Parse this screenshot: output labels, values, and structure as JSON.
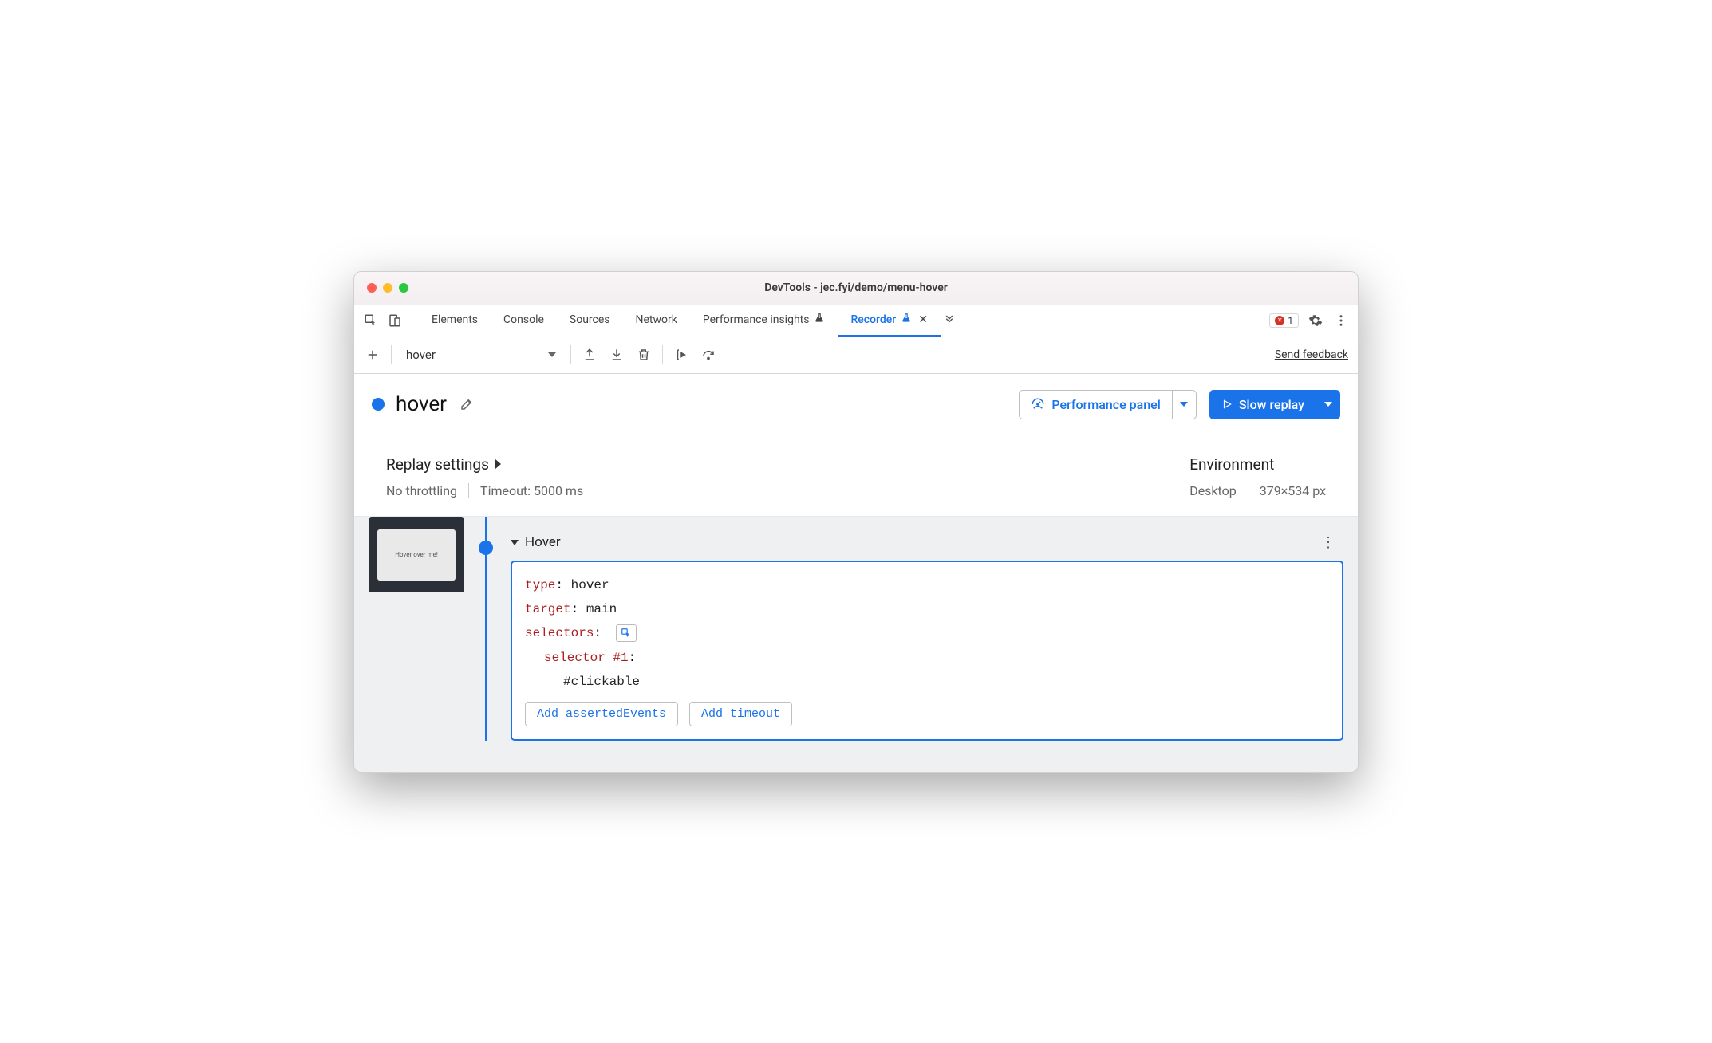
{
  "window": {
    "title": "DevTools - jec.fyi/demo/menu-hover"
  },
  "tabs": {
    "items": [
      {
        "label": "Elements",
        "active": false
      },
      {
        "label": "Console",
        "active": false
      },
      {
        "label": "Sources",
        "active": false
      },
      {
        "label": "Network",
        "active": false
      },
      {
        "label": "Performance insights",
        "active": false,
        "beaker": true
      },
      {
        "label": "Recorder",
        "active": true,
        "beaker": true,
        "closable": true
      }
    ]
  },
  "errors": {
    "count": "1"
  },
  "recorder_toolbar": {
    "recording_select": "hover",
    "feedback": "Send feedback"
  },
  "recording": {
    "name": "hover",
    "perf_button": "Performance panel",
    "replay_button": "Slow replay"
  },
  "settings": {
    "replay_title": "Replay settings",
    "throttling": "No throttling",
    "timeout": "Timeout: 5000 ms",
    "env_title": "Environment",
    "device": "Desktop",
    "dimensions": "379×534 px"
  },
  "thumbnail": {
    "caption": "Hover over me!"
  },
  "step": {
    "title": "Hover",
    "details": {
      "type_key": "type",
      "type_val": "hover",
      "target_key": "target",
      "target_val": "main",
      "selectors_key": "selectors",
      "selector1_key": "selector #1",
      "selector1_val": "#clickable"
    },
    "actions": {
      "asserted": "Add assertedEvents",
      "timeout": "Add timeout"
    }
  }
}
